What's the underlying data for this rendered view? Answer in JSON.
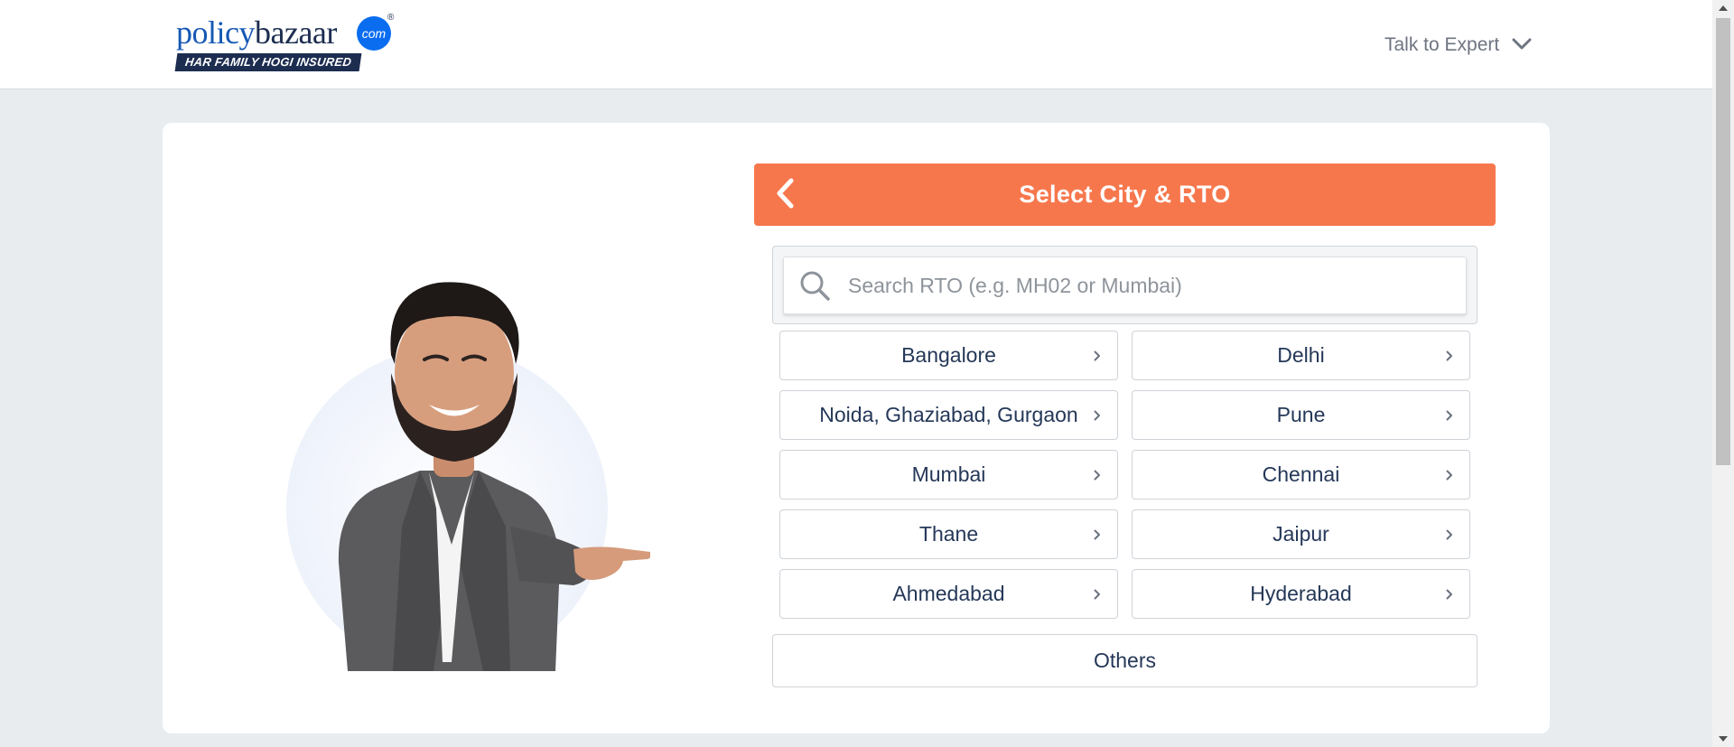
{
  "header": {
    "logo": {
      "word_part1": "policy",
      "word_part2": "bazaar",
      "badge": "com",
      "registered": "®",
      "tagline": "HAR FAMILY HOGI INSURED"
    },
    "talk_to_expert": "Talk to Expert"
  },
  "hero": {
    "image": "person-pointing-illustration"
  },
  "panel": {
    "title": "Select City & RTO",
    "back_icon": "chevron-left-icon"
  },
  "search": {
    "placeholder": "Search RTO (e.g. MH02 or Mumbai)",
    "value": ""
  },
  "cities": [
    "Bangalore",
    "Delhi",
    "Noida, Ghaziabad, Gurgaon",
    "Pune",
    "Mumbai",
    "Chennai",
    "Thane",
    "Jaipur",
    "Ahmedabad",
    "Hyderabad"
  ],
  "others_label": "Others",
  "colors": {
    "accent": "#f7774d",
    "brand_blue": "#1658b4",
    "brand_navy": "#1c2d50",
    "text_primary": "#253858",
    "page_bg": "#e9ecef"
  }
}
